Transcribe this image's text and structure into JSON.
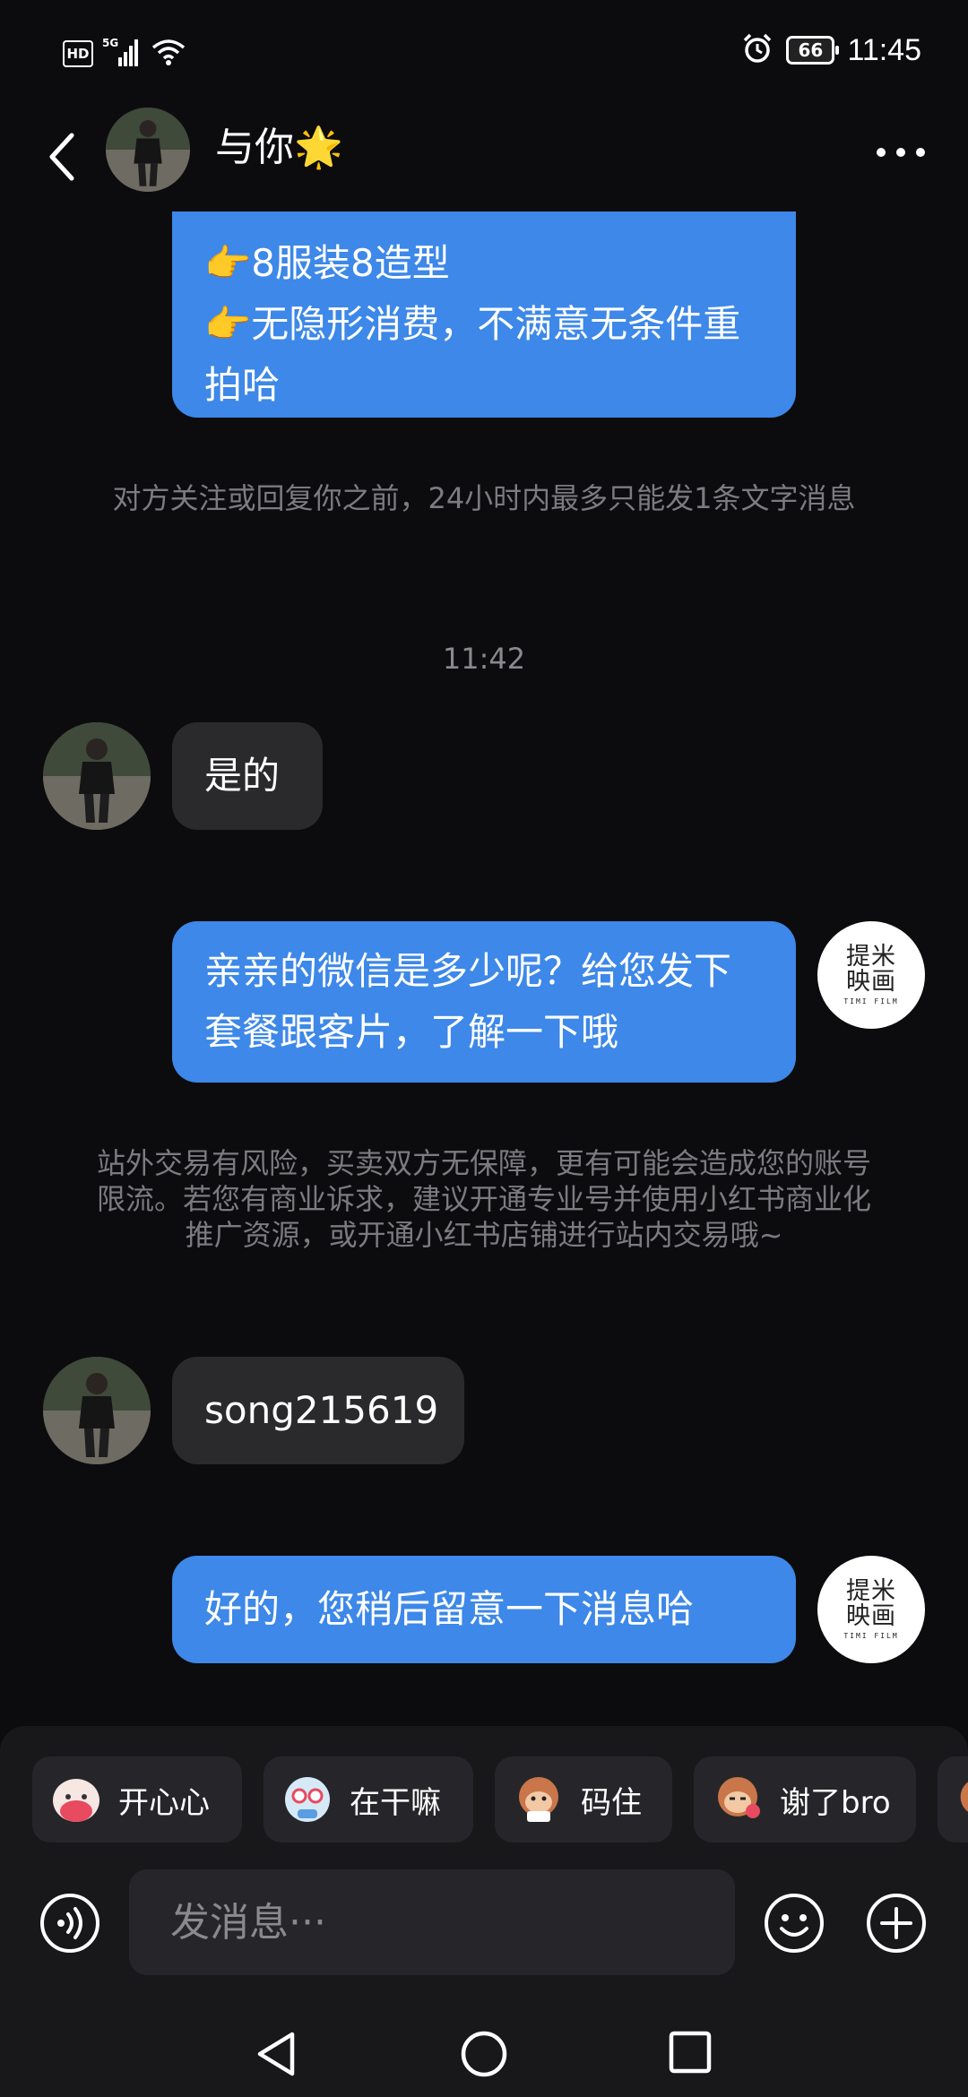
{
  "status_bar": {
    "hd": "HD",
    "network": "5G",
    "battery": "66",
    "time": "11:45"
  },
  "header": {
    "contact_name": "与你🌟"
  },
  "messages": {
    "m1_line1": "👉8服装8造型",
    "m1_line2": "👉无隐形消费，不满意无条件重拍哈",
    "sys1": "对方关注或回复你之前，24小时内最多只能发1条文字消息",
    "time1": "11:42",
    "m2": "是的",
    "m3": "亲亲的微信是多少呢？给您发下套餐跟客片，了解一下哦",
    "sys2": "站外交易有风险，买卖双方无保障，更有可能会造成您的账号限流。若您有商业诉求，建议开通专业号并使用小红书商业化推广资源，或开通小红书店铺进行站内交易哦~",
    "m4": "song215619",
    "m5": "好的，您稍后留意一下消息哈"
  },
  "brand_avatar": {
    "cn": "提米映画",
    "en": "TIMI FILM"
  },
  "quick_replies": [
    "开心心",
    "在干嘛",
    "码住",
    "谢了bro"
  ],
  "input": {
    "placeholder": "发消息···"
  },
  "colors": {
    "bubble_me": "#3d88e8",
    "bubble_them": "#2a2a2d",
    "background": "#0c0c0e"
  }
}
